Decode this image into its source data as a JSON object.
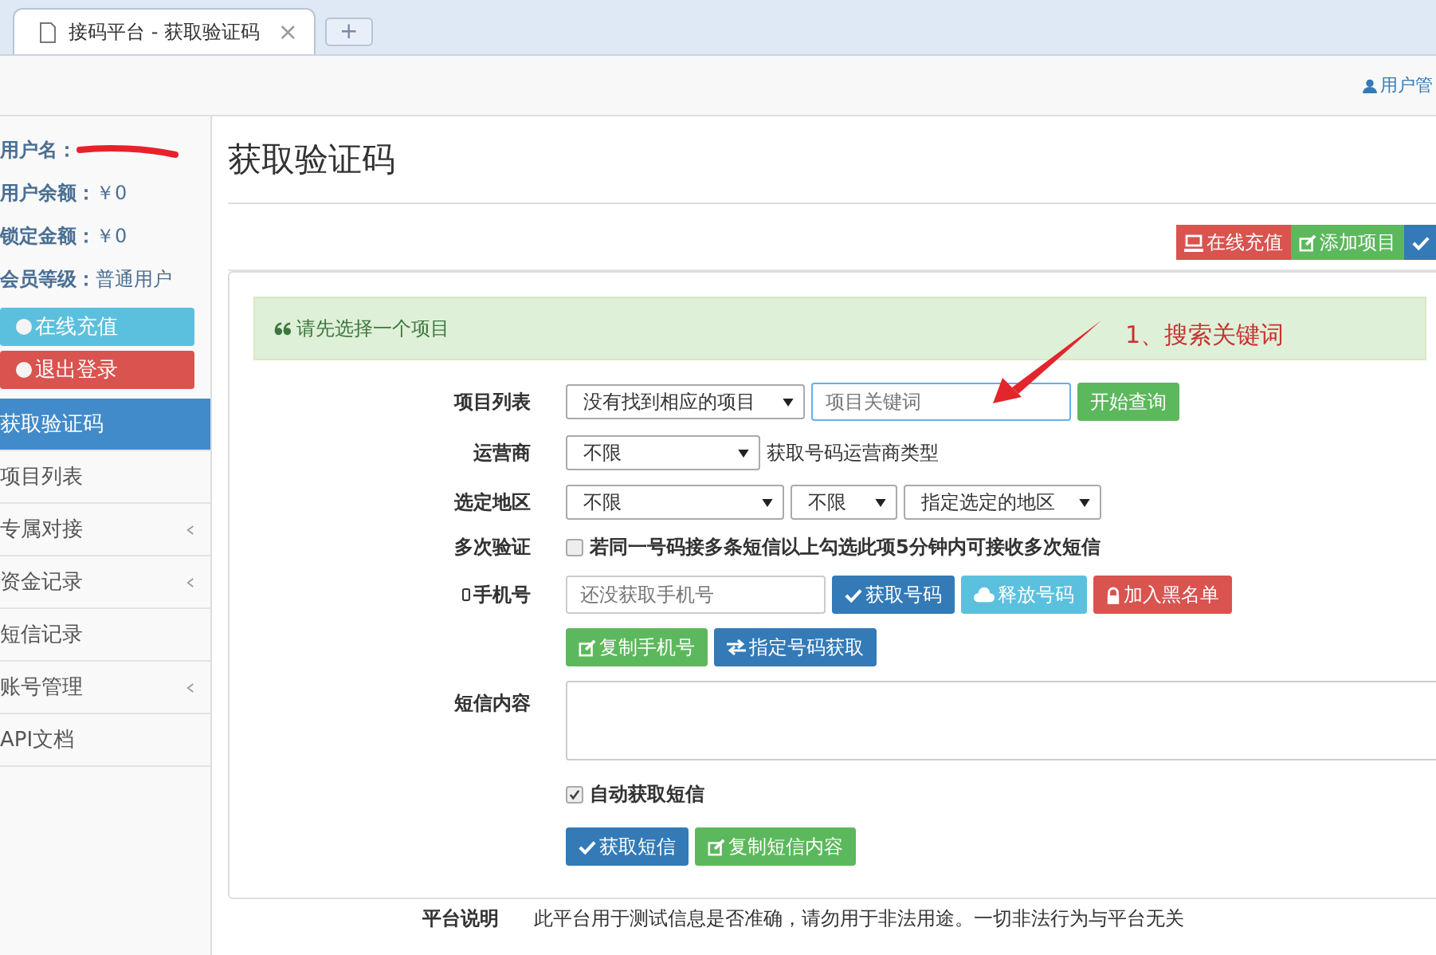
{
  "browser": {
    "tabs": [
      {
        "title": "接码平台 - 获取验证码",
        "close": "×",
        "selected": true
      }
    ],
    "new_tab": "+"
  },
  "navbar": {
    "user_menu": "用户管"
  },
  "sidebar": {
    "info": [
      {
        "label": "用户名：",
        "redacted": true
      },
      {
        "label": "用户余额：",
        "value": "￥0"
      },
      {
        "label": "锁定金额：",
        "value": "￥0"
      },
      {
        "label": "会员等级：",
        "value": "普通用户"
      }
    ],
    "buttons": [
      {
        "label": "在线充值",
        "kind": "info"
      },
      {
        "label": "退出登录",
        "kind": "danger"
      }
    ],
    "nav": [
      {
        "label": "获取验证码",
        "selected": true,
        "expandable": false
      },
      {
        "label": "项目列表",
        "selected": false,
        "expandable": false
      },
      {
        "label": "专属对接",
        "selected": false,
        "expandable": true
      },
      {
        "label": "资金记录",
        "selected": false,
        "expandable": true
      },
      {
        "label": "短信记录",
        "selected": false,
        "expandable": false
      },
      {
        "label": "账号管理",
        "selected": false,
        "expandable": true
      },
      {
        "label": "API文档",
        "selected": false,
        "expandable": false
      }
    ]
  },
  "main": {
    "title": "获取验证码",
    "toolbar": [
      {
        "label": "在线充值",
        "kind": "danger"
      },
      {
        "label": "添加项目",
        "kind": "success"
      },
      {
        "kind": "primary"
      }
    ],
    "alert": "请先选择一个项目",
    "annotation": "1、搜索关键词",
    "form": {
      "project": {
        "label": "项目列表",
        "select": "没有找到相应的项目",
        "placeholder": "项目关键词",
        "button": "开始查询"
      },
      "carrier": {
        "label": "运营商",
        "select": "不限",
        "hint": "获取号码运营商类型"
      },
      "region": {
        "label": "选定地区",
        "selects": [
          "不限",
          "不限",
          "指定选定的地区"
        ]
      },
      "multi": {
        "label": "多次验证",
        "checked": false,
        "text": "若同一号码接多条短信以上勾选此项5分钟内可接收多次短信"
      },
      "phone": {
        "label": "手机号",
        "placeholder": "还没获取手机号",
        "buttons": [
          {
            "label": "获取号码",
            "kind": "primary"
          },
          {
            "label": "释放号码",
            "kind": "info"
          },
          {
            "label": "加入黑名单",
            "kind": "danger"
          }
        ],
        "buttons2": [
          {
            "label": "复制手机号",
            "kind": "success"
          },
          {
            "label": "指定号码获取",
            "kind": "primary"
          }
        ]
      },
      "sms": {
        "label": "短信内容"
      },
      "auto": {
        "label": "自动获取短信",
        "checked": true
      },
      "sms_buttons": [
        {
          "label": "获取短信",
          "kind": "primary"
        },
        {
          "label": "复制短信内容",
          "kind": "success"
        }
      ]
    },
    "footer": {
      "label": "平台说明",
      "text": "此平台用于测试信息是否准确，请勿用于非法用途。一切非法行为与平台无关"
    }
  }
}
